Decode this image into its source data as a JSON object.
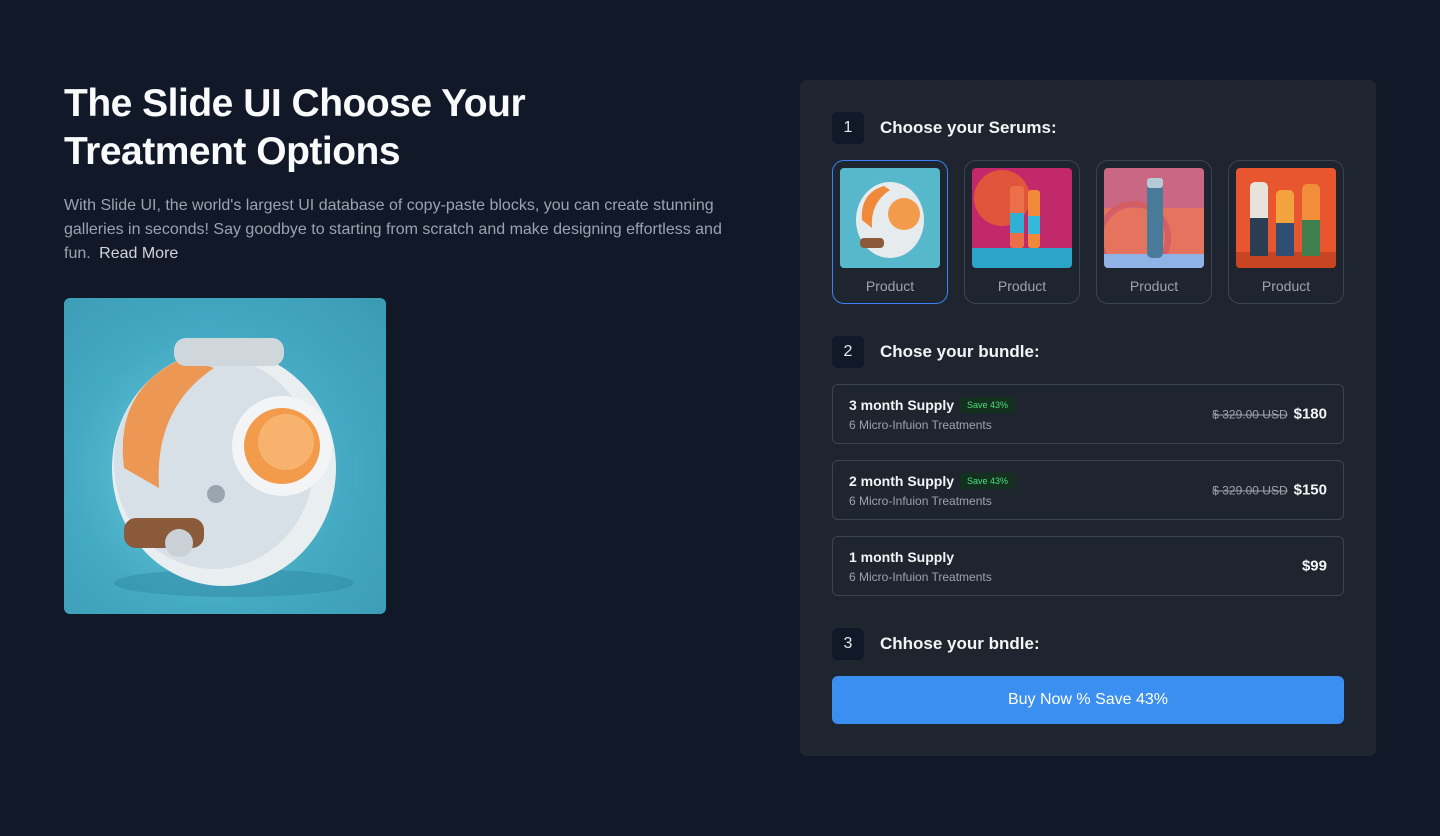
{
  "hero": {
    "title": "The Slide UI Choose Your Treatment Options",
    "description": "With Slide UI, the world's largest UI database of copy-paste blocks, you can create stunning galleries in seconds! Say goodbye to starting from scratch and make designing effortless and fun.",
    "read_more": "Read More"
  },
  "steps": [
    {
      "num": "1",
      "title": "Choose your Serums:"
    },
    {
      "num": "2",
      "title": "Chose your bundle:"
    },
    {
      "num": "3",
      "title": "Chhose your bndle:"
    }
  ],
  "products": [
    {
      "label": "Product",
      "selected": true
    },
    {
      "label": "Product",
      "selected": false
    },
    {
      "label": "Product",
      "selected": false
    },
    {
      "label": "Product",
      "selected": false
    }
  ],
  "bundles": [
    {
      "name": "3 month Supply",
      "badge": "Save 43%",
      "sub": "6 Micro-Infuion Treatments",
      "old_price": "$ 329.00 USD",
      "price": "$180"
    },
    {
      "name": "2 month Supply",
      "badge": "Save 43%",
      "sub": "6 Micro-Infuion Treatments",
      "old_price": "$ 329.00 USD",
      "price": "$150"
    },
    {
      "name": "1 month Supply",
      "badge": "",
      "sub": "6 Micro-Infuion Treatments",
      "old_price": "",
      "price": "$99"
    }
  ],
  "buy_button": "Buy Now % Save 43%",
  "colors": {
    "background": "#111827",
    "panel": "#1e252e",
    "accent": "#3b8ff0",
    "badge_text": "#4ade80"
  }
}
